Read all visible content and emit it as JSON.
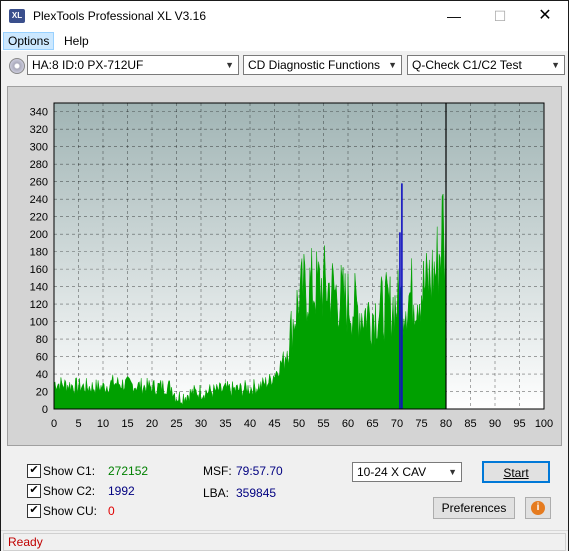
{
  "window": {
    "title": "PlexTools Professional XL V3.16",
    "app_icon_text": "XL"
  },
  "menu": {
    "items": [
      "Options",
      "Help"
    ]
  },
  "toolbar": {
    "drive": "HA:8 ID:0  PX-712UF",
    "function": "CD Diagnostic Functions",
    "test": "Q-Check C1/C2 Test"
  },
  "chart_data": {
    "type": "area",
    "x_ticks": [
      "0",
      "5",
      "10",
      "15",
      "20",
      "25",
      "30",
      "35",
      "40",
      "45",
      "50",
      "55",
      "60",
      "65",
      "70",
      "75",
      "80",
      "85",
      "90",
      "95",
      "100"
    ],
    "y_ticks": [
      "0",
      "20",
      "40",
      "60",
      "80",
      "100",
      "120",
      "140",
      "160",
      "180",
      "200",
      "220",
      "240",
      "260",
      "280",
      "300",
      "320",
      "340"
    ],
    "xlim": [
      0,
      100
    ],
    "ylim": [
      0,
      350
    ],
    "series": [
      {
        "color": "#00a000",
        "points": [
          [
            0,
            30
          ],
          [
            2,
            28
          ],
          [
            5,
            26
          ],
          [
            8,
            25
          ],
          [
            10,
            25
          ],
          [
            12,
            30
          ],
          [
            15,
            28
          ],
          [
            18,
            26
          ],
          [
            20,
            25
          ],
          [
            23,
            26
          ],
          [
            24,
            25
          ],
          [
            25,
            14
          ],
          [
            26,
            14
          ],
          [
            28,
            18
          ],
          [
            30,
            20
          ],
          [
            33,
            20
          ],
          [
            35,
            22
          ],
          [
            38,
            22
          ],
          [
            40,
            24
          ],
          [
            42,
            26
          ],
          [
            44,
            32
          ],
          [
            45,
            40
          ],
          [
            46,
            48
          ],
          [
            47,
            60
          ],
          [
            48,
            80
          ],
          [
            49,
            105
          ],
          [
            50,
            125
          ],
          [
            51,
            135
          ],
          [
            52,
            140
          ],
          [
            53,
            138
          ],
          [
            55,
            142
          ],
          [
            57,
            135
          ],
          [
            59,
            125
          ],
          [
            61,
            118
          ],
          [
            63,
            110
          ],
          [
            65,
            110
          ],
          [
            67,
            115
          ],
          [
            69,
            118
          ],
          [
            70,
            120
          ],
          [
            72,
            128
          ],
          [
            74,
            135
          ],
          [
            76,
            140
          ],
          [
            77,
            150
          ],
          [
            78,
            160
          ],
          [
            79,
            190
          ],
          [
            79.6,
            230
          ],
          [
            80,
            0
          ]
        ]
      },
      {
        "color": "#1010c0",
        "bars": [
          [
            71.0,
            258
          ],
          [
            70.6,
            202
          ]
        ]
      }
    ],
    "marker_line_x": 80,
    "marker_color": "#000000",
    "bg_top": "#a0b4b4",
    "bg_bottom": "#ffffff",
    "grid": true
  },
  "stats": {
    "c1_label": "Show C1:",
    "c1_value": "272152",
    "c1_color": "#008000",
    "c2_label": "Show C2:",
    "c2_value": "1992",
    "c2_color": "#000080",
    "cu_label": "Show CU:",
    "cu_value": "0",
    "cu_color": "#e00000",
    "msf_label": "MSF:",
    "msf_value": "79:57.70",
    "lba_label": "LBA:",
    "lba_value": "359845"
  },
  "controls": {
    "speed": "10-24 X CAV",
    "start_label": "Start",
    "prefs_label": "Preferences",
    "info_icon": "i"
  },
  "status": {
    "text": "Ready",
    "color": "#c00000"
  }
}
